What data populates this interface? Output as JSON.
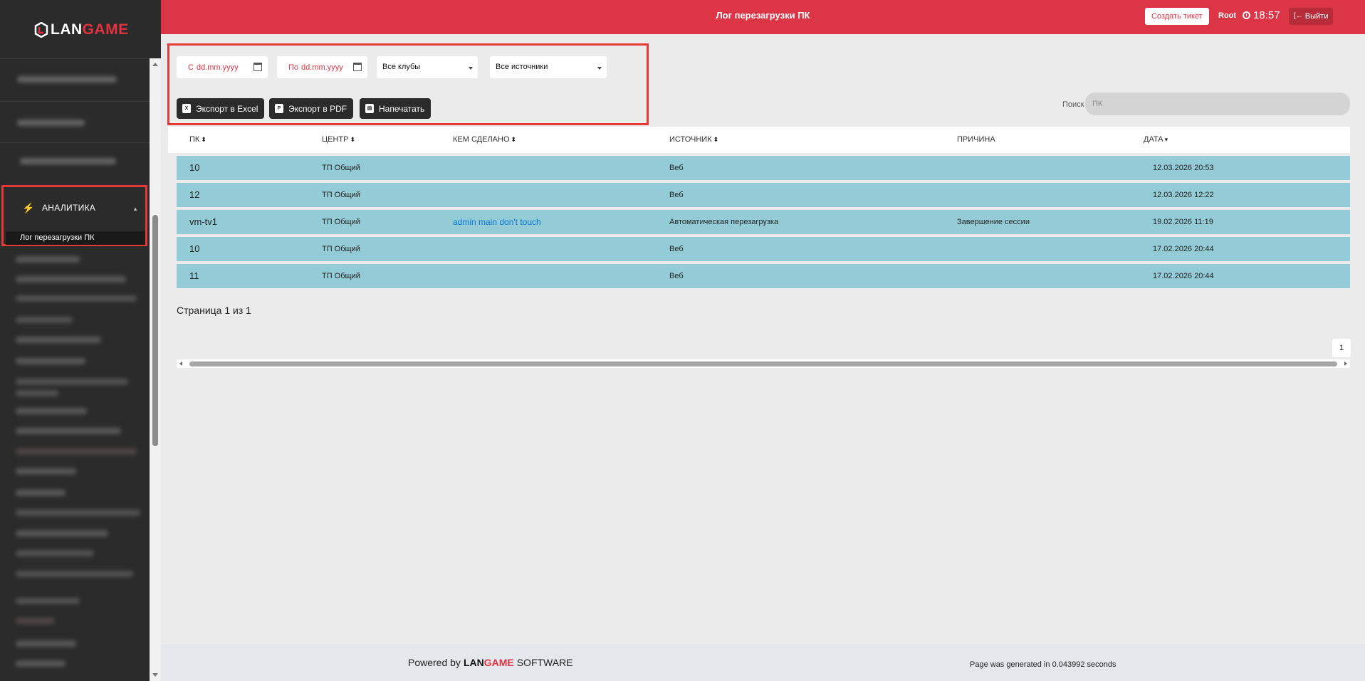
{
  "app": {
    "logo_lan": "LAN",
    "logo_game": "GAME",
    "brand_color": "#dc3545"
  },
  "header": {
    "title": "Лог перезагрузки ПК",
    "create_ticket": "Создать тикет",
    "user": "Root",
    "time": "18:57",
    "logout": "Выйти"
  },
  "sidebar": {
    "section_label": "АНАЛИТИКА",
    "section_icon": "bolt-icon",
    "active_item": "Лог перезагрузки ПК"
  },
  "filters": {
    "from_prefix": "С",
    "from_placeholder": "dd.mm.yyyy",
    "to_prefix": "По",
    "to_placeholder": "dd.mm.yyyy",
    "clubs_selected": "Все клубы",
    "sources_selected": "Все источники",
    "export_excel": "Экспорт в Excel",
    "export_pdf": "Экспорт в PDF",
    "print": "Напечатать"
  },
  "search": {
    "label": "Поиск",
    "placeholder": "ПК"
  },
  "table": {
    "columns": [
      "ПК",
      "ЦЕНТР",
      "КЕМ СДЕЛАНО",
      "ИСТОЧНИК",
      "ПРИЧИНА",
      "ДАТА"
    ],
    "rows": [
      {
        "pc": "10",
        "center": "ТП Общий",
        "by": "",
        "source": "Веб",
        "reason": "",
        "date": "12.03.2026 20:53"
      },
      {
        "pc": "12",
        "center": "ТП Общий",
        "by": "",
        "source": "Веб",
        "reason": "",
        "date": "12.03.2026 12:22"
      },
      {
        "pc": "vm-tv1",
        "center": "ТП Общий",
        "by": "admin main don't touch",
        "source": "Автоматическая перезагрузка",
        "reason": "Завершение сессии",
        "date": "19.02.2026 11:19"
      },
      {
        "pc": "10",
        "center": "ТП Общий",
        "by": "",
        "source": "Веб",
        "reason": "",
        "date": "17.02.2026 20:44"
      },
      {
        "pc": "11",
        "center": "ТП Общий",
        "by": "",
        "source": "Веб",
        "reason": "",
        "date": "17.02.2026 20:44"
      }
    ]
  },
  "pagination": {
    "info": "Страница 1 из 1",
    "current_page": "1"
  },
  "footer": {
    "powered_by": "Powered by",
    "brand_lan": "LAN",
    "brand_game": "GAME",
    "brand_suffix": "SOFTWARE",
    "generated": "Page was generated in 0.043992 seconds"
  }
}
